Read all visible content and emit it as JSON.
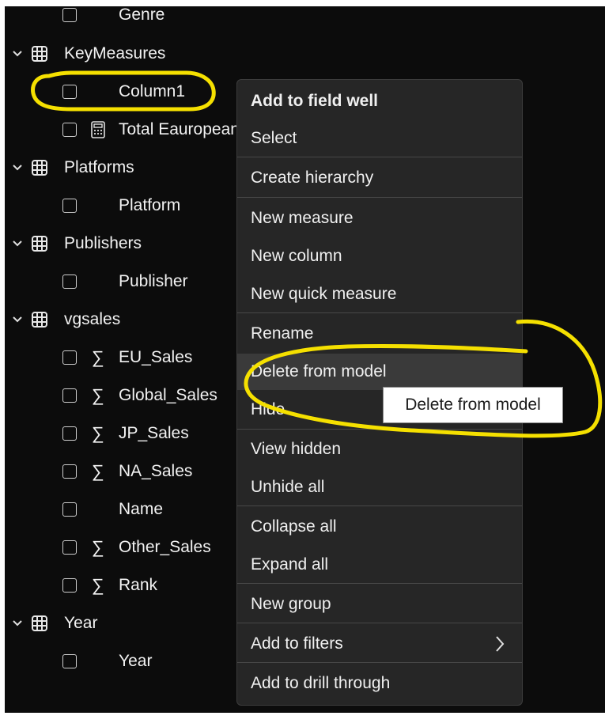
{
  "fields_pane": {
    "items": [
      {
        "kind": "field",
        "label": "Genre"
      },
      {
        "kind": "table",
        "label": "KeyMeasures"
      },
      {
        "kind": "field",
        "label": "Column1"
      },
      {
        "kind": "measure",
        "label": "Total Eauropean Sales"
      },
      {
        "kind": "table",
        "label": "Platforms"
      },
      {
        "kind": "field",
        "label": "Platform"
      },
      {
        "kind": "table",
        "label": "Publishers"
      },
      {
        "kind": "field",
        "label": "Publisher"
      },
      {
        "kind": "table",
        "label": "vgsales"
      },
      {
        "kind": "sum-field",
        "label": "EU_Sales"
      },
      {
        "kind": "sum-field",
        "label": "Global_Sales"
      },
      {
        "kind": "sum-field",
        "label": "JP_Sales"
      },
      {
        "kind": "sum-field",
        "label": "NA_Sales"
      },
      {
        "kind": "field",
        "label": "Name"
      },
      {
        "kind": "sum-field",
        "label": "Other_Sales"
      },
      {
        "kind": "sum-field",
        "label": "Rank"
      },
      {
        "kind": "table",
        "label": "Year"
      },
      {
        "kind": "field",
        "label": "Year"
      }
    ]
  },
  "context_menu": {
    "items": [
      {
        "label": "Add to field well"
      },
      {
        "label": "Select"
      },
      {
        "label": "Create hierarchy"
      },
      {
        "label": "New measure"
      },
      {
        "label": "New column"
      },
      {
        "label": "New quick measure"
      },
      {
        "label": "Rename"
      },
      {
        "label": "Delete from model",
        "hovered": true
      },
      {
        "label": "Hide"
      },
      {
        "label": "View hidden"
      },
      {
        "label": "Unhide all"
      },
      {
        "label": "Collapse all"
      },
      {
        "label": "Expand all"
      },
      {
        "label": "New group"
      },
      {
        "label": "Add to filters",
        "has_submenu": true
      },
      {
        "label": "Add to drill through"
      }
    ]
  },
  "tooltip": {
    "text": "Delete from model"
  },
  "icons": {
    "sigma": "∑",
    "submenu": "chevron-right-icon"
  },
  "colors": {
    "highlight": "#f5e000",
    "menu_bg": "#262626",
    "pane_bg": "#0c0c0c"
  }
}
